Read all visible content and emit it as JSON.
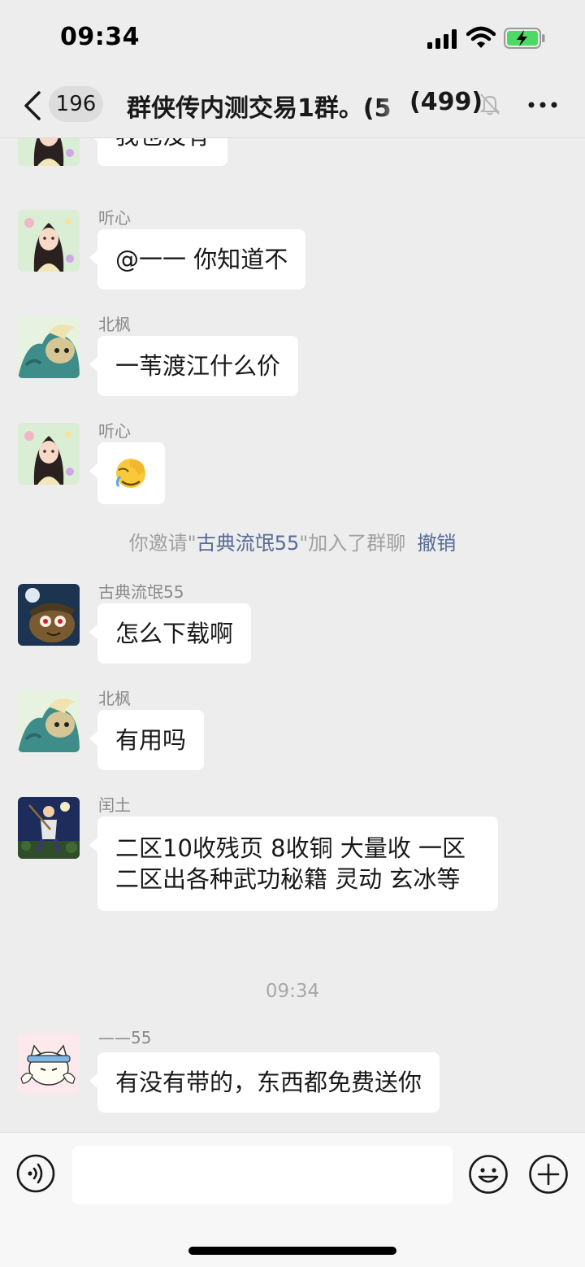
{
  "status_bar": {
    "time": "09:34"
  },
  "nav": {
    "unread_count": "196",
    "title": "群侠传内测交易1群。(5",
    "member_count": "(499)",
    "mute_icon": "bell-slash-icon",
    "more_icon": "more-dots-icon"
  },
  "messages": [
    {
      "sender": "",
      "text": "我也没有",
      "avatar": "avatar-girl"
    },
    {
      "sender": "听心",
      "text": "@一一 你知道不",
      "avatar": "avatar-girl"
    },
    {
      "sender": "北枫",
      "text": "一苇渡江什么价",
      "avatar": "avatar-beast"
    },
    {
      "sender": "听心",
      "text": "",
      "emoji": "facepalm-emoji",
      "avatar": "avatar-girl"
    },
    {
      "sender": "古典流氓55",
      "text": "怎么下载啊",
      "avatar": "avatar-night"
    },
    {
      "sender": "北枫",
      "text": "有用吗",
      "avatar": "avatar-beast"
    },
    {
      "sender": "闰土",
      "text": "二区10收残页 8收铜 大量收 一区二区出各种武功秘籍 灵动 玄冰等",
      "avatar": "avatar-runtu"
    },
    {
      "sender": "——55",
      "text": "有没有带的，东西都免费送你",
      "avatar": "avatar-cat"
    }
  ],
  "system_note": {
    "prefix": "你邀请\"",
    "name": "古典流氓55",
    "suffix": "\"加入了群聊",
    "revoke": "撤销"
  },
  "time_divider": "09:34",
  "input_bar": {
    "placeholder": ""
  },
  "colors": {
    "bg": "#ededed",
    "bubble": "#ffffff",
    "link": "#576b95",
    "meta": "#8a8a8a"
  }
}
